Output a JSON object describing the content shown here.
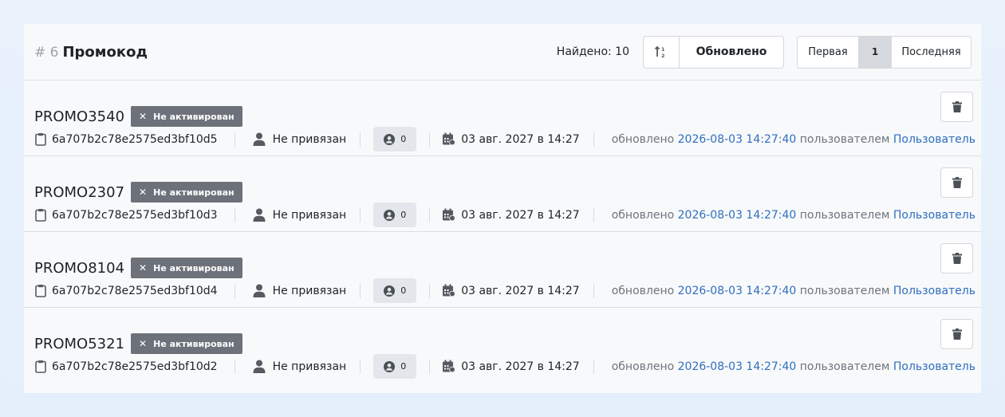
{
  "header": {
    "hash": "# 6",
    "title": "Промокод",
    "found": "Найдено: 10",
    "sort_label": "Обновлено",
    "pager": {
      "first": "Первая",
      "current": "1",
      "last": "Последняя"
    }
  },
  "rows": [
    {
      "code": "PROMO3540",
      "status": "Не активирован",
      "id": "6a707b2c78e2575ed3bf10d5",
      "owner": "Не привязан",
      "count": "0",
      "date": "03 авг. 2027 в 14:27",
      "upd_prefix": "обновлено",
      "upd_time": "2026-08-03 14:27:40",
      "upd_mid": "пользователем",
      "upd_user": "Пользователь"
    },
    {
      "code": "PROMO2307",
      "status": "Не активирован",
      "id": "6a707b2c78e2575ed3bf10d3",
      "owner": "Не привязан",
      "count": "0",
      "date": "03 авг. 2027 в 14:27",
      "upd_prefix": "обновлено",
      "upd_time": "2026-08-03 14:27:40",
      "upd_mid": "пользователем",
      "upd_user": "Пользователь"
    },
    {
      "code": "PROMO8104",
      "status": "Не активирован",
      "id": "6a707b2c78e2575ed3bf10d4",
      "owner": "Не привязан",
      "count": "0",
      "date": "03 авг. 2027 в 14:27",
      "upd_prefix": "обновлено",
      "upd_time": "2026-08-03 14:27:40",
      "upd_mid": "пользователем",
      "upd_user": "Пользователь"
    },
    {
      "code": "PROMO5321",
      "status": "Не активирован",
      "id": "6a707b2c78e2575ed3bf10d2",
      "owner": "Не привязан",
      "count": "0",
      "date": "03 авг. 2027 в 14:27",
      "upd_prefix": "обновлено",
      "upd_time": "2026-08-03 14:27:40",
      "upd_mid": "пользователем",
      "upd_user": "Пользователь"
    }
  ],
  "icons": {
    "sort": "sort-icon",
    "clipboard": "clipboard-icon",
    "user": "user-icon",
    "user_circle": "user-circle-icon",
    "calendar": "calendar-icon",
    "trash": "trash-icon",
    "close": "close-icon"
  },
  "colors": {
    "badge": "#6c717a",
    "link": "#2f6fbe",
    "muted": "#6c757d"
  }
}
